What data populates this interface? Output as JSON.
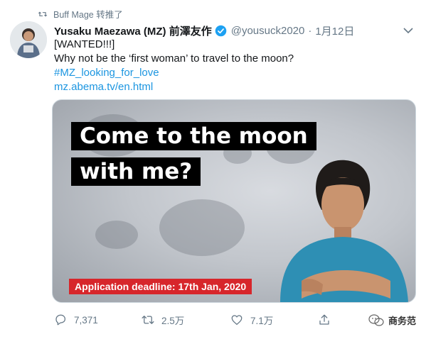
{
  "retweet": {
    "text": "Buff Mage 转推了",
    "icon": "retweet-icon"
  },
  "tweet": {
    "author_name": "Yusaku Maezawa (MZ) 前澤友作",
    "handle": "@yousuck2020",
    "separator": "·",
    "time": "1月12日",
    "lines": {
      "wanted": "[WANTED!!!]",
      "question": "Why not be the ‘first woman’ to travel to the moon?",
      "hashtag": "#MZ_looking_for_love",
      "link": "mz.abema.tv/en.html"
    }
  },
  "media": {
    "headline_line1": "Come to the moon",
    "headline_line2": "with me?",
    "deadline": "Application deadline: 17th Jan, 2020"
  },
  "actions": {
    "replies": "7,371",
    "retweets": "2.5万",
    "likes": "7.1万"
  },
  "watermark": {
    "text": "商务范"
  },
  "colors": {
    "link": "#1b95e0",
    "muted": "#657786",
    "verified": "#1da1f2",
    "deadline_bg": "#d7262b"
  }
}
